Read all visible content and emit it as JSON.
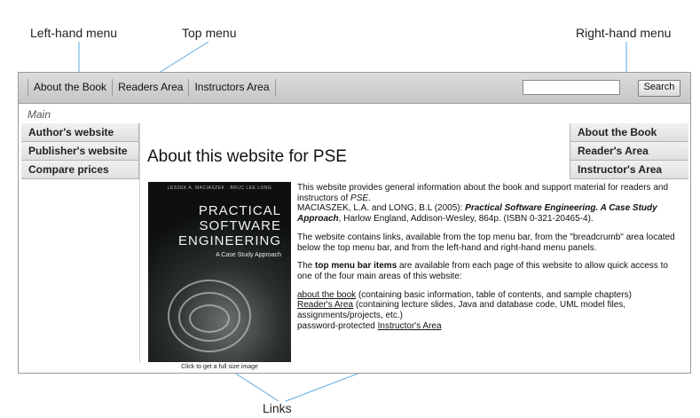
{
  "callouts": {
    "left_menu": "Left-hand menu",
    "top_menu": "Top menu",
    "right_menu": "Right-hand menu",
    "links": "Links"
  },
  "top_menu": {
    "items": [
      "About the Book",
      "Readers Area",
      "Instructors Area"
    ],
    "search_value": "",
    "search_button": "Search"
  },
  "breadcrumb": "Main",
  "left_menu": {
    "items": [
      "Author's website",
      "Publisher's website",
      "Compare prices"
    ]
  },
  "right_menu": {
    "items": [
      "About the Book",
      "Reader's Area",
      "Instructor's Area"
    ]
  },
  "main": {
    "title": "About this website for PSE",
    "cover": {
      "authors": "LESZEK A. MACIASZEK · BRUC LEE LONG",
      "title_line1": "PRACTICAL",
      "title_line2": "SOFTWARE",
      "title_line3": "ENGINEERING",
      "subtitle": "A Case Study Approach",
      "caption": "Click to get a full size image"
    },
    "p1_text": "This website provides general information about the book and support material for readers and instructors of ",
    "p1_em": "PSE",
    "p1_end": ".",
    "p1_ref_authors": "MACIASZEK, L.A. and LONG, B.L (2005): ",
    "p1_ref_title": "Practical Software Engineering. A Case Study Approach",
    "p1_ref_rest": ", Harlow England, Addison-Wesley, 864p. (ISBN 0-321-20465-4).",
    "p2": "The website contains links, available from the top menu bar, from the \"breadcrumb\" area located below the top menu bar, and from the left-hand and right-hand menu panels.",
    "p3_lead": "The ",
    "p3_bold": "top menu bar items",
    "p3_rest": " are available from each page of this website to allow quick access to one of the four main areas of this website:",
    "link1": "about the book",
    "link1_desc": " (containing basic information, table of contents, and sample chapters)",
    "link2": "Reader's Area",
    "link2_desc": " (containing lecture slides, Java and database code, UML model files, assignments/projects, etc.)",
    "link3_prefix": "password-protected ",
    "link3": "Instructor's Area"
  }
}
